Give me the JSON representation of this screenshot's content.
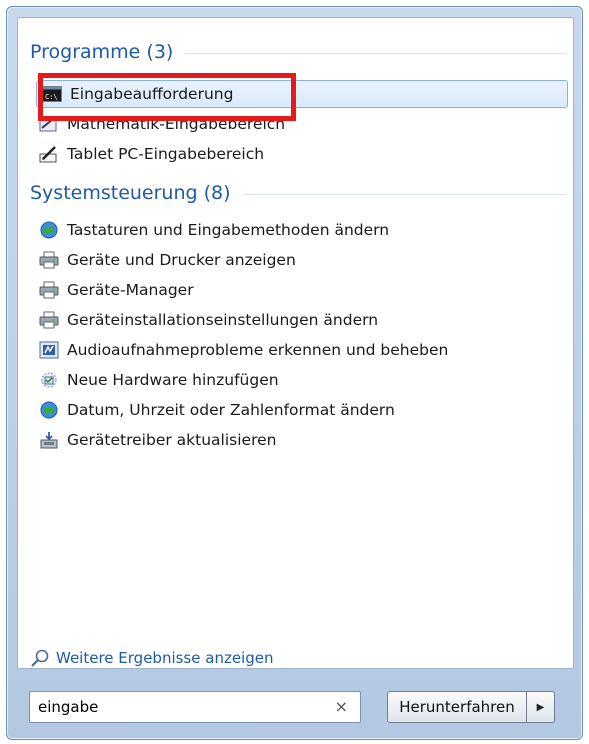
{
  "programs": {
    "title": "Programme (3)",
    "items": [
      {
        "label": "Eingabeaufforderung",
        "icon": "command-prompt-icon"
      },
      {
        "label": "Mathematik-Eingabebereich",
        "icon": "math-input-icon"
      },
      {
        "label": "Tablet PC-Eingabebereich",
        "icon": "tablet-pen-icon"
      }
    ]
  },
  "control_panel": {
    "title": "Systemsteuerung (8)",
    "items": [
      {
        "label": "Tastaturen und Eingabemethoden ändern",
        "icon": "globe-icon"
      },
      {
        "label": "Geräte und Drucker anzeigen",
        "icon": "printer-icon"
      },
      {
        "label": "Geräte-Manager",
        "icon": "printer-icon"
      },
      {
        "label": "Geräteinstallationseinstellungen ändern",
        "icon": "printer-icon"
      },
      {
        "label": "Audioaufnahmeprobleme erkennen und beheben",
        "icon": "audio-troubleshoot-icon"
      },
      {
        "label": "Neue Hardware hinzufügen",
        "icon": "add-hardware-icon"
      },
      {
        "label": "Datum, Uhrzeit oder Zahlenformat ändern",
        "icon": "globe-icon"
      },
      {
        "label": "Gerätetreiber aktualisieren",
        "icon": "driver-update-icon"
      }
    ]
  },
  "more_results": {
    "label": "Weitere Ergebnisse anzeigen",
    "icon": "search-icon"
  },
  "search": {
    "value": "eingabe",
    "clear": "×"
  },
  "shutdown": {
    "label": "Herunterfahren",
    "arrow": "▶"
  },
  "colors": {
    "header_text": "#1e5aa8",
    "highlight": "#e31b1b",
    "selection": "#d9eafb"
  }
}
